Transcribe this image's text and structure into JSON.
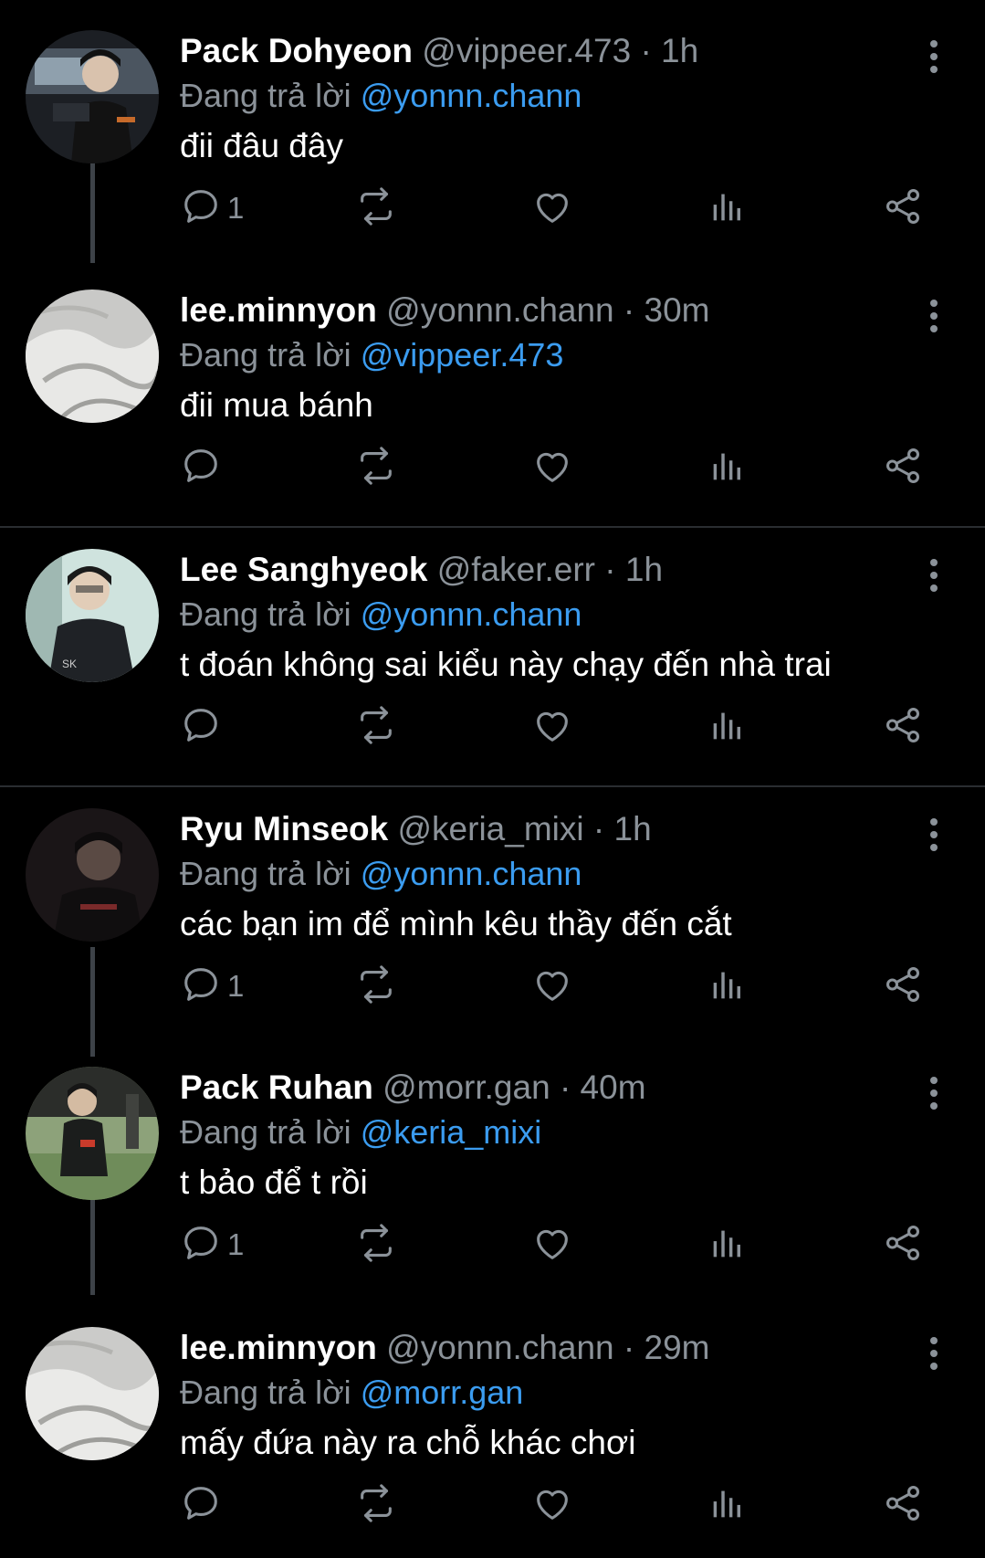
{
  "reply_prefix": "Đang trả lời",
  "tweets": [
    {
      "name": "Pack Dohyeon",
      "handle": "@vippeer.473",
      "dot": "·",
      "time": "1h",
      "reply_to": "@yonnn.chann",
      "text": "đii đâu đây",
      "reply_count": "1"
    },
    {
      "name": "lee.minnyon",
      "handle": "@yonnn.chann",
      "dot": "·",
      "time": "30m",
      "reply_to": "@vippeer.473",
      "text": "đii mua bánh",
      "reply_count": ""
    },
    {
      "name": "Lee Sanghyeok",
      "handle": "@faker.err",
      "dot": "·",
      "time": "1h",
      "reply_to": "@yonnn.chann",
      "text": "t đoán không sai kiểu này chạy đến nhà trai",
      "reply_count": ""
    },
    {
      "name": "Ryu Minseok",
      "handle": "@keria_mixi",
      "dot": "·",
      "time": "1h",
      "reply_to": "@yonnn.chann",
      "text": "các bạn im để mình kêu thầy đến cắt",
      "reply_count": "1"
    },
    {
      "name": "Pack Ruhan",
      "handle": "@morr.gan",
      "dot": "·",
      "time": "40m",
      "reply_to": "@keria_mixi",
      "text": "t bảo để t rồi",
      "reply_count": "1"
    },
    {
      "name": "lee.minnyon",
      "handle": "@yonnn.chann",
      "dot": "·",
      "time": "29m",
      "reply_to": "@morr.gan",
      "text": "mấy đứa này ra chỗ khác chơi",
      "reply_count": ""
    }
  ],
  "icons": {
    "more": "more-vertical-icon",
    "reply": "reply-icon",
    "retweet": "retweet-icon",
    "like": "heart-icon",
    "views": "views-icon",
    "share": "share-icon"
  },
  "colors": {
    "background": "#000000",
    "name": "#ffffff",
    "muted": "#8b9299",
    "mention": "#3b9cf0",
    "divider": "#2a2d31",
    "thread_line": "#3d4248"
  }
}
